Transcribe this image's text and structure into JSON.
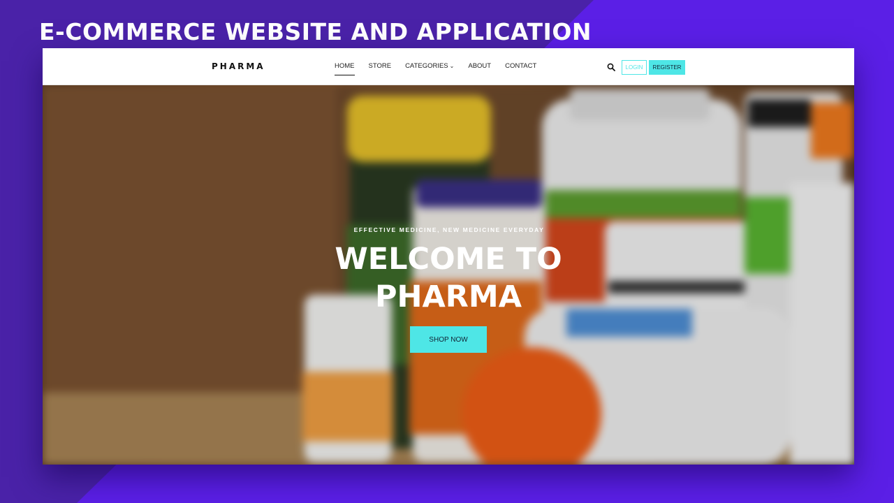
{
  "slide": {
    "title": "E-COMMERCE WEBSITE AND APPLICATION"
  },
  "site": {
    "logo": "PHARMA",
    "nav": [
      {
        "label": "HOME",
        "active": true
      },
      {
        "label": "STORE",
        "active": false
      },
      {
        "label": "CATEGORIES",
        "active": false,
        "has_dropdown": true
      },
      {
        "label": "ABOUT",
        "active": false
      },
      {
        "label": "CONTACT",
        "active": false
      }
    ],
    "login_label": "LOGIN",
    "register_label": "REGISTER",
    "icons": {
      "search": "search-icon",
      "dropdown": "chevron-down-icon"
    }
  },
  "hero": {
    "subtitle": "EFFECTIVE MEDICINE, NEW MEDICINE EVERYDAY",
    "title_line1": "WELCOME TO",
    "title_line2": "PHARMA",
    "cta_label": "SHOP NOW"
  },
  "colors": {
    "accent": "#4ee6e6",
    "background_purple": "#5b1fe6",
    "background_dark": "#4a22a8"
  }
}
